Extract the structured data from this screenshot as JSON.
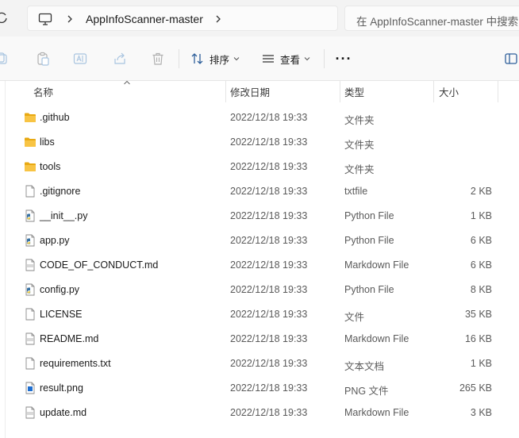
{
  "address_bar": {
    "breadcrumb_folder": "AppInfoScanner-master",
    "search_placeholder": "在 AppInfoScanner-master 中搜索"
  },
  "command_bar": {
    "sort_label": "排序",
    "view_label": "查看",
    "more_label": "···"
  },
  "columns": {
    "name": "名称",
    "modified": "修改日期",
    "type": "类型",
    "size": "大小"
  },
  "files": [
    {
      "name": ".github",
      "modified": "2022/12/18 19:33",
      "type": "文件夹",
      "size": "",
      "icon": "folder-icon"
    },
    {
      "name": "libs",
      "modified": "2022/12/18 19:33",
      "type": "文件夹",
      "size": "",
      "icon": "folder-icon"
    },
    {
      "name": "tools",
      "modified": "2022/12/18 19:33",
      "type": "文件夹",
      "size": "",
      "icon": "folder-icon"
    },
    {
      "name": ".gitignore",
      "modified": "2022/12/18 19:33",
      "type": "txtfile",
      "size": "2 KB",
      "icon": "text-file-icon"
    },
    {
      "name": "__init__.py",
      "modified": "2022/12/18 19:33",
      "type": "Python File",
      "size": "1 KB",
      "icon": "python-file-icon"
    },
    {
      "name": "app.py",
      "modified": "2022/12/18 19:33",
      "type": "Python File",
      "size": "6 KB",
      "icon": "python-file-icon"
    },
    {
      "name": "CODE_OF_CONDUCT.md",
      "modified": "2022/12/18 19:33",
      "type": "Markdown File",
      "size": "6 KB",
      "icon": "markdown-file-icon"
    },
    {
      "name": "config.py",
      "modified": "2022/12/18 19:33",
      "type": "Python File",
      "size": "8 KB",
      "icon": "python-file-icon"
    },
    {
      "name": "LICENSE",
      "modified": "2022/12/18 19:33",
      "type": "文件",
      "size": "35 KB",
      "icon": "blank-file-icon"
    },
    {
      "name": "README.md",
      "modified": "2022/12/18 19:33",
      "type": "Markdown File",
      "size": "16 KB",
      "icon": "markdown-file-icon"
    },
    {
      "name": "requirements.txt",
      "modified": "2022/12/18 19:33",
      "type": "文本文档",
      "size": "1 KB",
      "icon": "text-file-icon"
    },
    {
      "name": "result.png",
      "modified": "2022/12/18 19:33",
      "type": "PNG 文件",
      "size": "265 KB",
      "icon": "image-file-icon"
    },
    {
      "name": "update.md",
      "modified": "2022/12/18 19:33",
      "type": "Markdown File",
      "size": "3 KB",
      "icon": "markdown-file-icon"
    }
  ],
  "colors": {
    "folder": "#f8c444",
    "python_blue": "#3772a4",
    "python_yellow": "#f7d04a",
    "png_blue": "#1f6fd1"
  }
}
